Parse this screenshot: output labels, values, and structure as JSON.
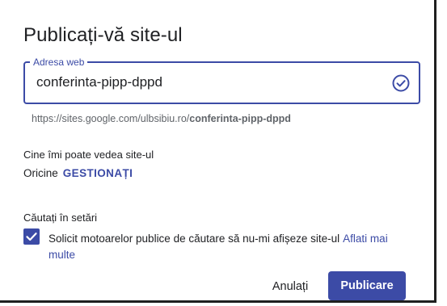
{
  "dialog": {
    "title": "Publicați-vă site-ul",
    "web_address": {
      "label": "Adresa web",
      "value": "conferinta-pipp-dppd",
      "status_icon": "check-circle-icon",
      "url_prefix": "https://sites.google.com/ulbsibiu.ro/",
      "url_slug": "conferinta-pipp-dppd"
    },
    "visibility": {
      "heading": "Cine îmi poate vedea site-ul",
      "value": "Oricine",
      "manage_label": "GESTIONAȚI"
    },
    "search": {
      "heading": "Căutați în setări",
      "checked": true,
      "checkbox_text": "Solicit motoarelor publice de căutare să nu-mi afișeze site-ul",
      "learn_more_label": "Aflati mai multe"
    },
    "actions": {
      "cancel_label": "Anulați",
      "publish_label": "Publicare"
    }
  },
  "colors": {
    "accent": "#3c4ba6",
    "text": "#202124",
    "muted": "#5f6368"
  }
}
